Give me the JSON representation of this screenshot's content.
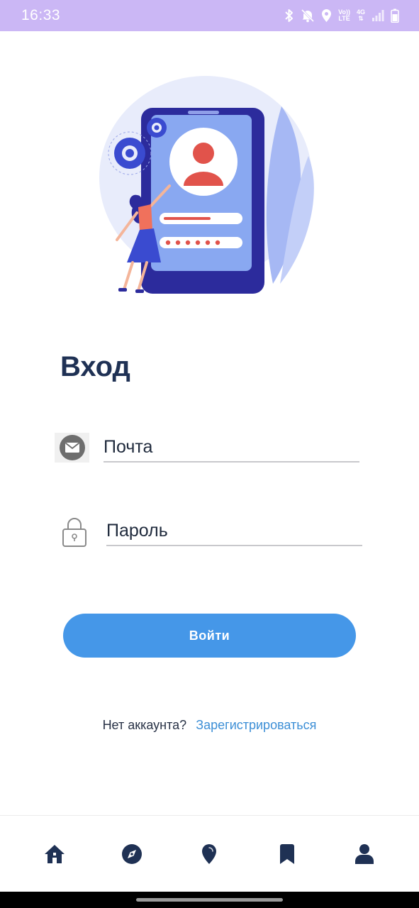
{
  "status_bar": {
    "time": "16:33",
    "network_label_top": "Vo))",
    "network_label_bottom": "LTE",
    "network_gen": "4G",
    "icons": [
      "bluetooth-icon",
      "mute-icon",
      "location-icon",
      "signal-icon",
      "battery-icon"
    ]
  },
  "login": {
    "title": "Вход",
    "email_placeholder": "Почта",
    "email_value": "",
    "password_placeholder": "Пароль",
    "password_value": "",
    "submit_label": "Войти",
    "no_account_text": "Нет аккаунта?",
    "register_link": "Зарегистрироваться"
  },
  "bottom_nav": {
    "items": [
      "home-icon",
      "compass-icon",
      "location-pin-icon",
      "bookmark-icon",
      "profile-icon"
    ],
    "active": "none"
  },
  "colors": {
    "status_bar": "#cbb7f5",
    "title": "#1f3154",
    "button": "#4597e8",
    "link": "#3d8fd6",
    "nav_icon": "#1f3154"
  }
}
